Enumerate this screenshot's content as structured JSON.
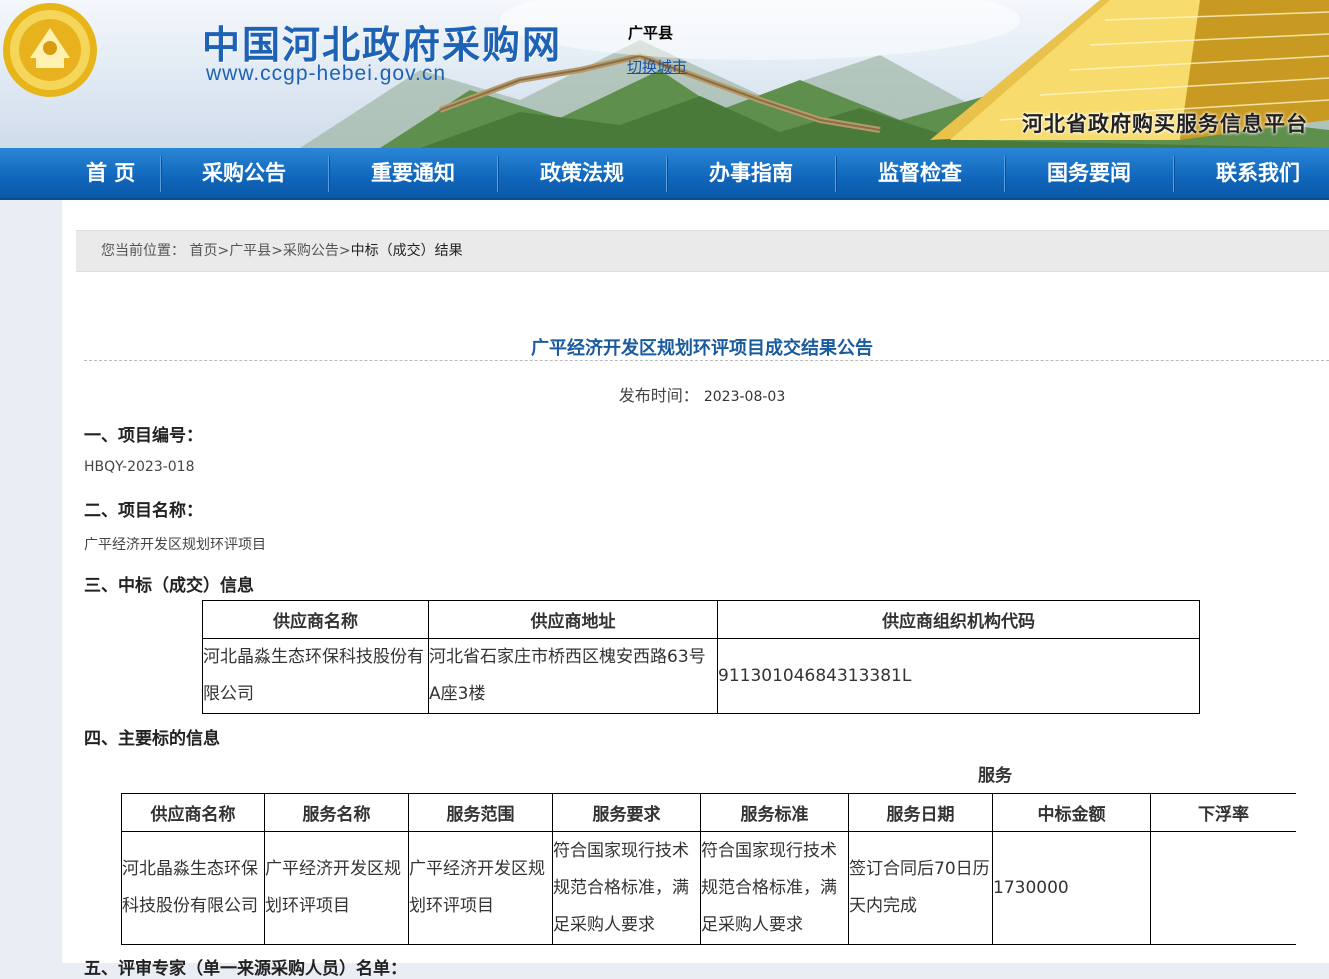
{
  "header": {
    "site_title": "中国河北政府采购网",
    "site_url": "www.ccgp-hebei.gov.cn",
    "region": "广平县",
    "switch_city": "切换城市",
    "platform": "河北省政府购买服务信息平台"
  },
  "nav": {
    "items": [
      "首 页",
      "采购公告",
      "重要通知",
      "政策法规",
      "办事指南",
      "监督检查",
      "国务要闻",
      "联系我们"
    ]
  },
  "breadcrumb": {
    "prefix": "您当前位置：",
    "items": [
      "首页",
      "广平县",
      "采购公告"
    ],
    "current": "中标（成交）结果",
    "sep": ">"
  },
  "article": {
    "title": "广平经济开发区规划环评项目成交结果公告",
    "date_label": "发布时间：",
    "date": "2023-08-03",
    "sec1_heading": "一、项目编号：",
    "sec1_value": "HBQY-2023-018",
    "sec2_heading": "二、项目名称：",
    "sec2_value": "广平经济开发区规划环评项目",
    "sec3_heading": "三、中标（成交）信息",
    "sec4_heading": "四、主要标的信息",
    "sec5_heading": "五、评审专家（单一来源采购人员）名单："
  },
  "supplier_table": {
    "headers": [
      "供应商名称",
      "供应商地址",
      "供应商组织机构代码"
    ],
    "rows": [
      [
        "河北晶淼生态环保科技股份有限公司",
        "河北省石家庄市桥西区槐安西路63号A座3楼",
        "91130104684313381L"
      ]
    ]
  },
  "service_table": {
    "group_label": "服务",
    "headers": [
      "供应商名称",
      "服务名称",
      "服务范围",
      "服务要求",
      "服务标准",
      "服务日期",
      "中标金额",
      "下浮率"
    ],
    "rows": [
      [
        "河北晶淼生态环保科技股份有限公司",
        "广平经济开发区规划环评项目",
        "广平经济开发区规划环评项目",
        "符合国家现行技术规范合格标准，满足采购人要求",
        "符合国家现行技术规范合格标准，满足采购人要求",
        "签订合同后70日历天内完成",
        "1730000",
        ""
      ]
    ]
  },
  "colors": {
    "nav": "#1066bb",
    "title": "#1a5a9e",
    "brand": "#1d62b5"
  }
}
